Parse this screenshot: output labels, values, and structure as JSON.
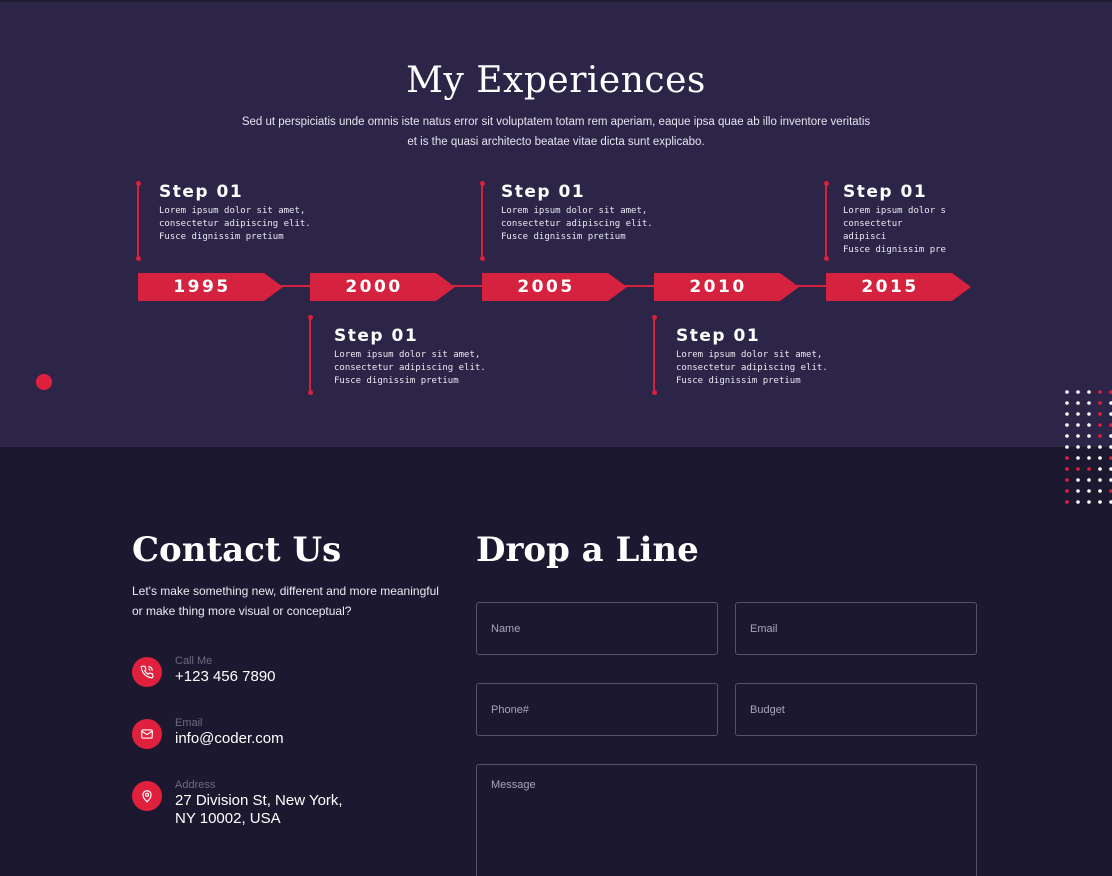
{
  "experiences": {
    "title": "My Experiences",
    "subtitle": "Sed ut perspiciatis unde omnis iste natus error sit voluptatem  totam rem aperiam, eaque ipsa quae ab illo inventore veritatis et is the quasi architecto beatae vitae dicta sunt explicabo.",
    "timeline": [
      {
        "year": "1995",
        "step_title": "Step 01",
        "step_text": "Lorem ipsum dolor sit amet,\nconsectetur adipiscing elit.\nFusce dignissim pretium"
      },
      {
        "year": "2000",
        "step_title": "Step 01",
        "step_text": "Lorem ipsum dolor sit amet,\nconsectetur adipiscing elit.\nFusce dignissim pretium"
      },
      {
        "year": "2005",
        "step_title": "Step 01",
        "step_text": "Lorem ipsum dolor sit amet,\nconsectetur adipiscing elit.\nFusce dignissim pretium"
      },
      {
        "year": "2010",
        "step_title": "Step 01",
        "step_text": "Lorem ipsum dolor sit amet,\nconsectetur adipiscing elit.\nFusce dignissim pretium"
      },
      {
        "year": "2015",
        "step_title": "Step 01",
        "step_text": "Lorem ipsum dolor s\nconsectetur adipisci\nFusce dignissim pre"
      }
    ]
  },
  "contact": {
    "title": "Contact Us",
    "subtitle": "Let's make something new, different and more meaningful or make thing more visual or conceptual?",
    "items": [
      {
        "icon": "phone-icon",
        "label": "Call Me",
        "value": "+123 456 7890"
      },
      {
        "icon": "mail-icon",
        "label": "Email",
        "value": "info@coder.com"
      },
      {
        "icon": "location-pin-icon",
        "label": "Address",
        "value": "27 Division St, New York,\nNY 10002, USA"
      }
    ]
  },
  "form": {
    "title": "Drop a Line",
    "name_placeholder": "Name",
    "email_placeholder": "Email",
    "phone_placeholder": "Phone#",
    "budget_placeholder": "Budget",
    "message_placeholder": "Message"
  },
  "colors": {
    "accent": "#e0213e",
    "section_bg": "#2c2548",
    "page_bg": "#1c1830"
  }
}
